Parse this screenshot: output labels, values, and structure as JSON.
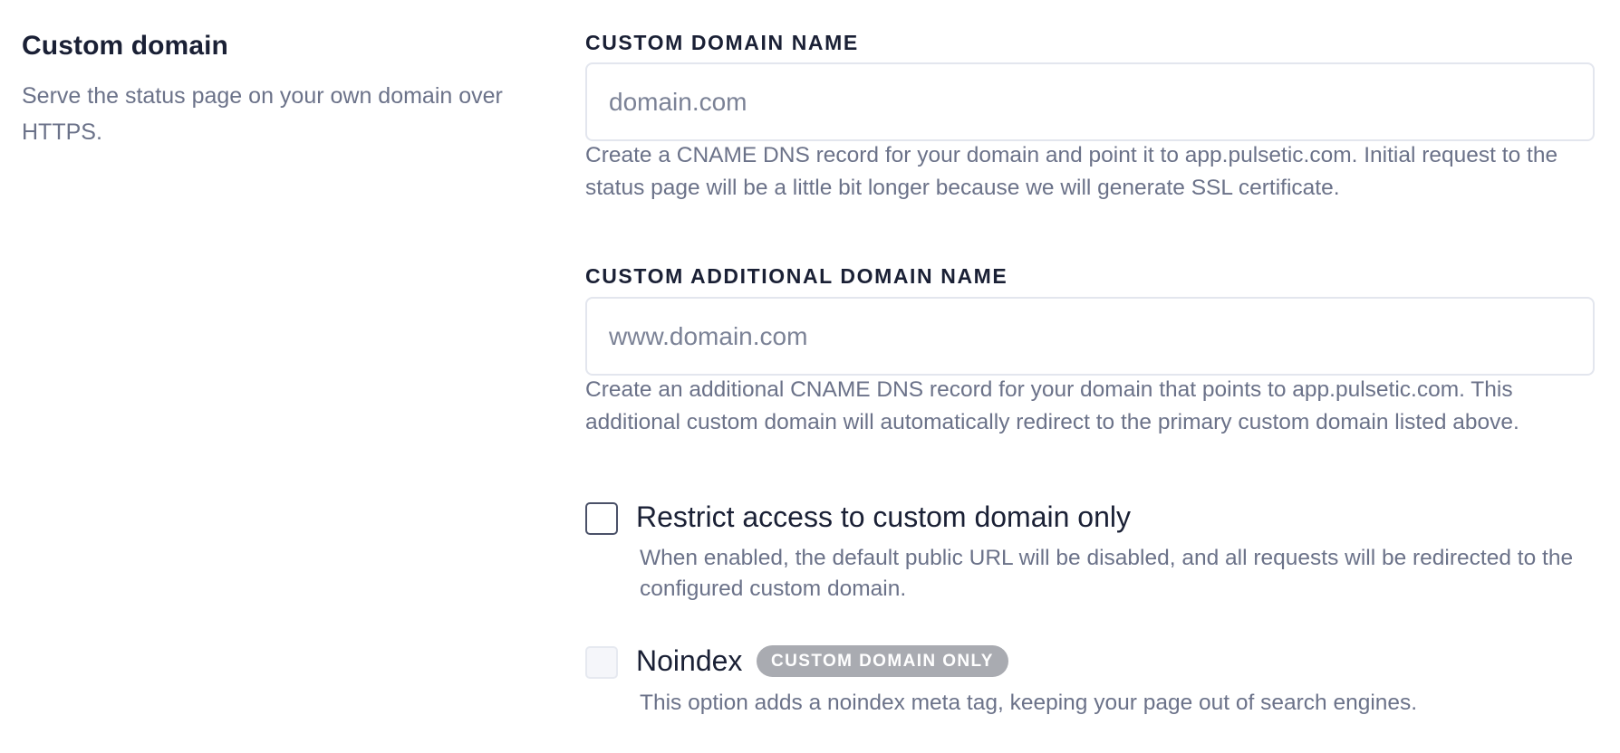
{
  "section": {
    "title": "Custom domain",
    "description": "Serve the status page on your own domain over HTTPS."
  },
  "custom_domain": {
    "label": "CUSTOM DOMAIN NAME",
    "value": "",
    "placeholder": "domain.com",
    "help": "Create a CNAME DNS record for your domain and point it to app.pulsetic.com. Initial request to the status page will be a little bit longer because we will generate SSL certificate."
  },
  "additional_domain": {
    "label": "CUSTOM ADDITIONAL DOMAIN NAME",
    "value": "",
    "placeholder": "www.domain.com",
    "help": "Create an additional CNAME DNS record for your domain that points to app.pulsetic.com. This additional custom domain will automatically redirect to the primary custom domain listed above."
  },
  "restrict_access": {
    "label": "Restrict access to custom domain only",
    "checked": false,
    "enabled": true,
    "help": "When enabled, the default public URL will be disabled, and all requests will be redirected to the configured custom domain."
  },
  "noindex": {
    "label": "Noindex",
    "checked": false,
    "enabled": false,
    "badge": "CUSTOM DOMAIN ONLY",
    "help": "This option adds a noindex meta tag, keeping your page out of search engines."
  },
  "colors": {
    "heading": "#1a2035",
    "muted_text": "#6b7289",
    "input_border": "#e3e6ee",
    "badge_bg": "#a9abb1"
  }
}
